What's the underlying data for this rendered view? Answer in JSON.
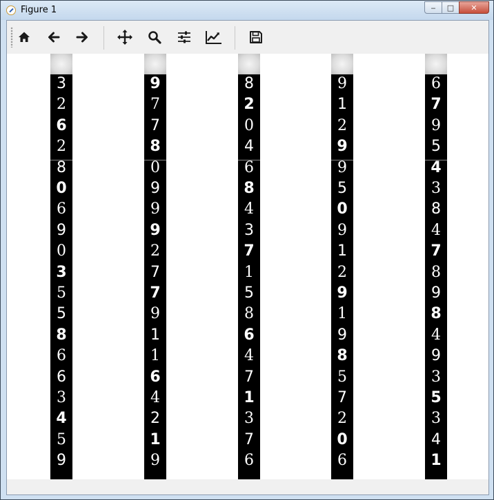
{
  "window": {
    "title": "Figure 1",
    "minimize_glyph": "‒",
    "maximize_glyph": "□",
    "close_glyph": "✕"
  },
  "toolbar": {
    "buttons": [
      {
        "name": "home-icon",
        "label": "Home"
      },
      {
        "name": "back-icon",
        "label": "Back"
      },
      {
        "name": "forward-icon",
        "label": "Forward"
      },
      {
        "name": "pan-icon",
        "label": "Pan"
      },
      {
        "name": "zoom-icon",
        "label": "Zoom"
      },
      {
        "name": "subplots-icon",
        "label": "Configure subplots"
      },
      {
        "name": "edit-axis-icon",
        "label": "Edit axis"
      },
      {
        "name": "save-icon",
        "label": "Save"
      }
    ]
  },
  "strips": [
    {
      "digits": [
        "3",
        "2",
        "6",
        "2",
        "8",
        "0",
        "6",
        "9",
        "0",
        "3",
        "5",
        "5",
        "8",
        "6",
        "6",
        "3",
        "4",
        "5",
        "9"
      ]
    },
    {
      "digits": [
        "9",
        "7",
        "7",
        "8",
        "0",
        "9",
        "9",
        "9",
        "2",
        "7",
        "7",
        "9",
        "1",
        "1",
        "6",
        "4",
        "2",
        "1",
        "9"
      ]
    },
    {
      "digits": [
        "8",
        "2",
        "0",
        "4",
        "6",
        "8",
        "4",
        "3",
        "7",
        "1",
        "5",
        "8",
        "6",
        "4",
        "7",
        "1",
        "3",
        "7",
        "6"
      ]
    },
    {
      "digits": [
        "9",
        "1",
        "2",
        "9",
        "9",
        "5",
        "0",
        "9",
        "1",
        "2",
        "9",
        "1",
        "9",
        "8",
        "5",
        "7",
        "2",
        "0",
        "6"
      ]
    },
    {
      "digits": [
        "6",
        "7",
        "9",
        "5",
        "4",
        "3",
        "8",
        "4",
        "7",
        "8",
        "9",
        "8",
        "4",
        "9",
        "3",
        "5",
        "3",
        "4",
        "1"
      ]
    }
  ],
  "colors": {
    "strip_background": "#000000",
    "digit_color": "#ffffff",
    "canvas_background": "#ffffff"
  }
}
